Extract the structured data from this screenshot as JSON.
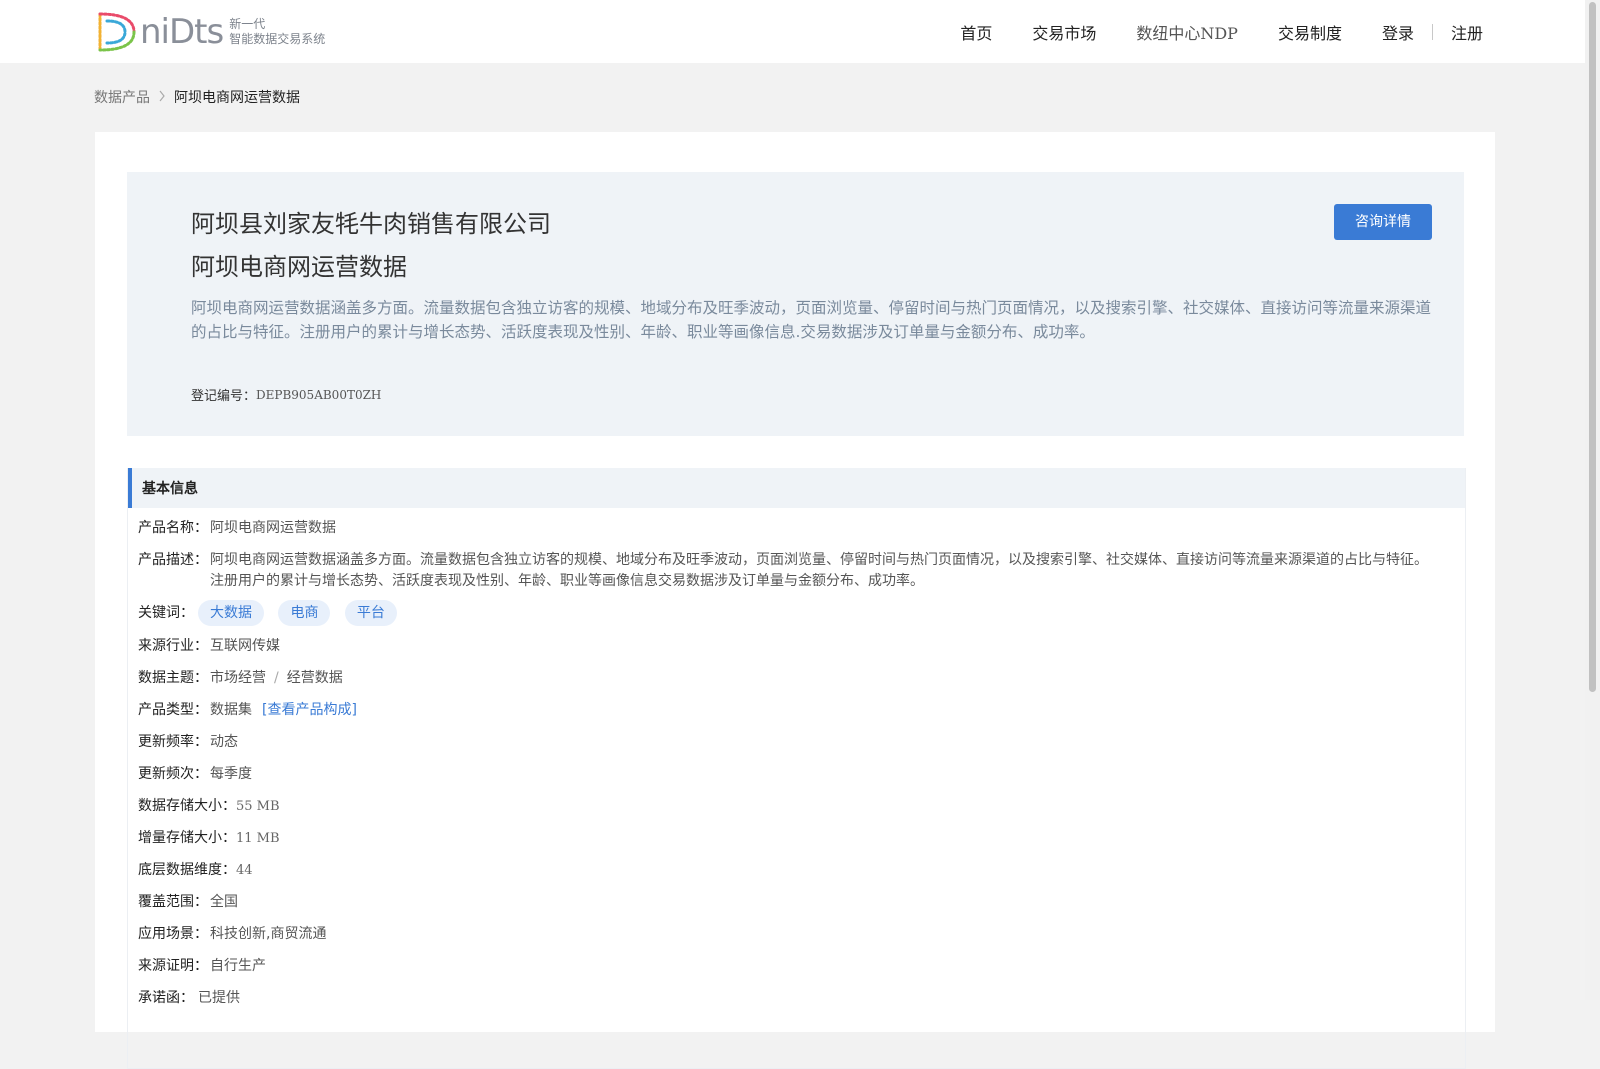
{
  "header": {
    "logo_word": "niDts",
    "logo_sub_line1": "新一代",
    "logo_sub_line2": "智能数据交易系统",
    "nav": [
      {
        "label": "首页"
      },
      {
        "label": "交易市场"
      },
      {
        "label": "数纽中心NDP"
      },
      {
        "label": "交易制度"
      }
    ],
    "login": "登录",
    "register": "注册"
  },
  "breadcrumb": {
    "parent": "数据产品",
    "separator": ">",
    "current": "阿坝电商网运营数据"
  },
  "hero": {
    "company": "阿坝县刘家友牦牛肉销售有限公司",
    "product": "阿坝电商网运营数据",
    "description": "阿坝电商网运营数据涵盖多方面。流量数据包含独立访客的规模、地域分布及旺季波动，页面浏览量、停留时间与热门页面情况，以及搜索引擎、社交媒体、直接访问等流量来源渠道的占比与特征。注册用户的累计与增长态势、活跃度表现及性别、年龄、职业等画像信息.交易数据涉及订单量与金额分布、成功率。",
    "reg_label": "登记编号：",
    "reg_value": "DEPB905AB00T0ZH",
    "consult_button": "咨询详情"
  },
  "basic_info": {
    "title": "基本信息",
    "product_name_label": "产品名称：",
    "product_name": "阿坝电商网运营数据",
    "product_desc_label": "产品描述：",
    "product_desc": "阿坝电商网运营数据涵盖多方面。流量数据包含独立访客的规模、地域分布及旺季波动，页面浏览量、停留时间与热门页面情况，以及搜索引擎、社交媒体、直接访问等流量来源渠道的占比与特征。注册用户的累计与增长态势、活跃度表现及性别、年龄、职业等画像信息交易数据涉及订单量与金额分布、成功率。",
    "keywords_label": "关键词：",
    "keywords": [
      "大数据",
      "电商",
      "平台"
    ],
    "industry_label": "来源行业：",
    "industry": "互联网传媒",
    "theme_label": "数据主题：",
    "theme_main": "市场经营",
    "theme_sep": "/",
    "theme_sub": "经营数据",
    "type_label": "产品类型：",
    "type": "数据集",
    "type_link": "[查看产品构成]",
    "freq_label": "更新频率：",
    "freq": "动态",
    "times_label": "更新频次：",
    "times": "每季度",
    "storage_label": "数据存储大小：",
    "storage": "55 MB",
    "inc_storage_label": "增量存储大小：",
    "inc_storage": "11 MB",
    "dims_label": "底层数据维度：",
    "dims": "44",
    "coverage_label": "覆盖范围：",
    "coverage": "全国",
    "scenario_label": "应用场景：",
    "scenario": "科技创新,商贸流通",
    "proof_label": "来源证明：",
    "proof": "自行生产",
    "commit_label": "承诺函：",
    "commit": "已提供"
  }
}
